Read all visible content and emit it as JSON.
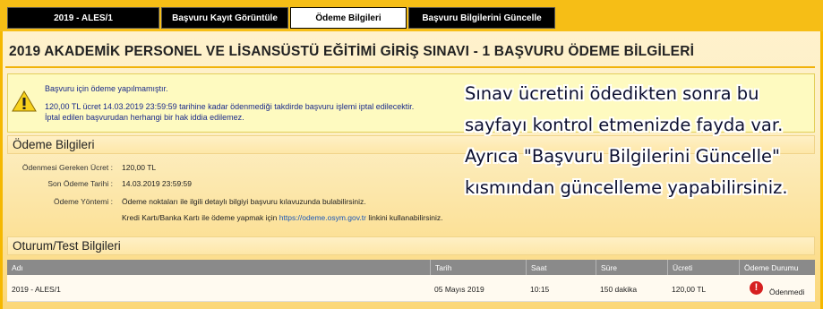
{
  "tabs": [
    {
      "label": "2019 - ALES/1",
      "active": false
    },
    {
      "label": "Başvuru Kayıt Görüntüle",
      "active": false
    },
    {
      "label": "Ödeme Bilgileri",
      "active": true
    },
    {
      "label": "Başvuru Bilgilerini Güncelle",
      "active": false
    }
  ],
  "page_title": "2019 AKADEMİK PERSONEL VE LİSANSÜSTÜ EĞİTİMİ GİRİŞ SINAVI - 1 BAŞVURU ÖDEME BİLGİLERİ",
  "warning": {
    "icon": "warning-triangle-icon",
    "line1": "Başvuru için ödeme yapılmamıştır.",
    "line2": "120,00 TL ücret 14.03.2019 23:59:59 tarihine kadar ödenmediği takdirde başvuru işlemi iptal edilecektir.",
    "line3": "İptal edilen başvurudan herhangi bir hak iddia edilemez."
  },
  "payment": {
    "heading": "Ödeme Bilgileri",
    "amount_label": "Ödenmesi Gereken Ücret :",
    "amount_value": "120,00 TL",
    "deadline_label": "Son Ödeme Tarihi :",
    "deadline_value": "14.03.2019 23:59:59",
    "method_label": "Ödeme Yöntemi :",
    "method_value": "Ödeme noktaları ile ilgili detaylı bilgiyi başvuru kılavuzunda bulabilirsiniz.",
    "card_prefix": "Kredi Kartı/Banka Kartı ile ödeme yapmak için",
    "card_link": "https://odeme.osym.gov.tr",
    "card_suffix": "linkini kullanabilirsiniz."
  },
  "session": {
    "heading": "Oturum/Test Bilgileri",
    "columns": [
      "Adı",
      "Tarih",
      "Saat",
      "Süre",
      "Ücreti",
      "Ödeme Durumu"
    ],
    "row": {
      "name": "2019 - ALES/1",
      "date": "05 Mayıs 2019",
      "time": "10:15",
      "duration": "150 dakika",
      "fee": "120,00 TL",
      "status_icon": "alert-circle-icon",
      "status": "Ödenmedi"
    }
  },
  "overlay_note": {
    "line1": "Sınav ücretini ödedikten sonra bu",
    "line2": "sayfayı kontrol etmenizde fayda var.",
    "line3": "Ayrıca \"Başvuru Bilgilerini Güncelle\"",
    "line4": "kısmından güncelleme yapabilirsiniz."
  }
}
